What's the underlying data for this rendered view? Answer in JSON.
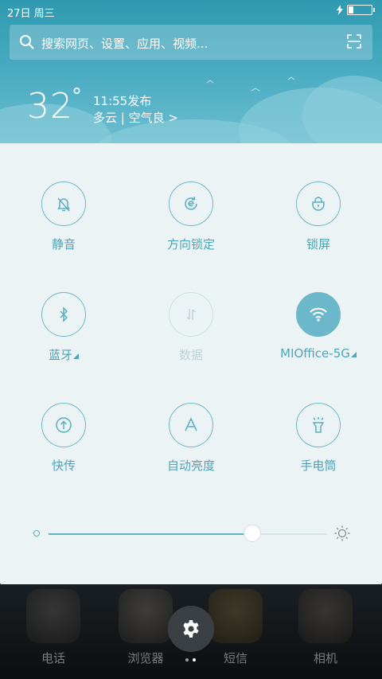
{
  "status": {
    "date": "27日 周三"
  },
  "search": {
    "placeholder": "搜索网页、设置、应用、视频..."
  },
  "weather": {
    "temp": "32",
    "deg": "°",
    "time": "11:55发布",
    "condition": "多云 | 空气良 >"
  },
  "toggles": [
    {
      "label": "静音",
      "icon": "bell-off-icon",
      "state": "off-outline"
    },
    {
      "label": "方向锁定",
      "icon": "rotation-lock-icon",
      "state": "outline"
    },
    {
      "label": "锁屏",
      "icon": "lock-icon",
      "state": "outline"
    },
    {
      "label": "蓝牙",
      "icon": "bluetooth-icon",
      "state": "outline",
      "expand": true
    },
    {
      "label": "数据",
      "icon": "mobile-data-icon",
      "state": "disabled"
    },
    {
      "label": "MIOffice-5G",
      "icon": "wifi-icon",
      "state": "on",
      "expand": true
    },
    {
      "label": "快传",
      "icon": "share-icon",
      "state": "outline"
    },
    {
      "label": "自动亮度",
      "icon": "auto-brightness-icon",
      "state": "outline"
    },
    {
      "label": "手电筒",
      "icon": "flashlight-icon",
      "state": "outline"
    }
  ],
  "brightness": {
    "value": 0.73
  },
  "dock": {
    "apps": [
      {
        "label": "电话"
      },
      {
        "label": "浏览器"
      },
      {
        "label": "短信"
      },
      {
        "label": "相机"
      }
    ]
  },
  "colors": {
    "accent": "#5fb1c4",
    "panel": "#ecf3f5",
    "header": "#46a9c0"
  }
}
